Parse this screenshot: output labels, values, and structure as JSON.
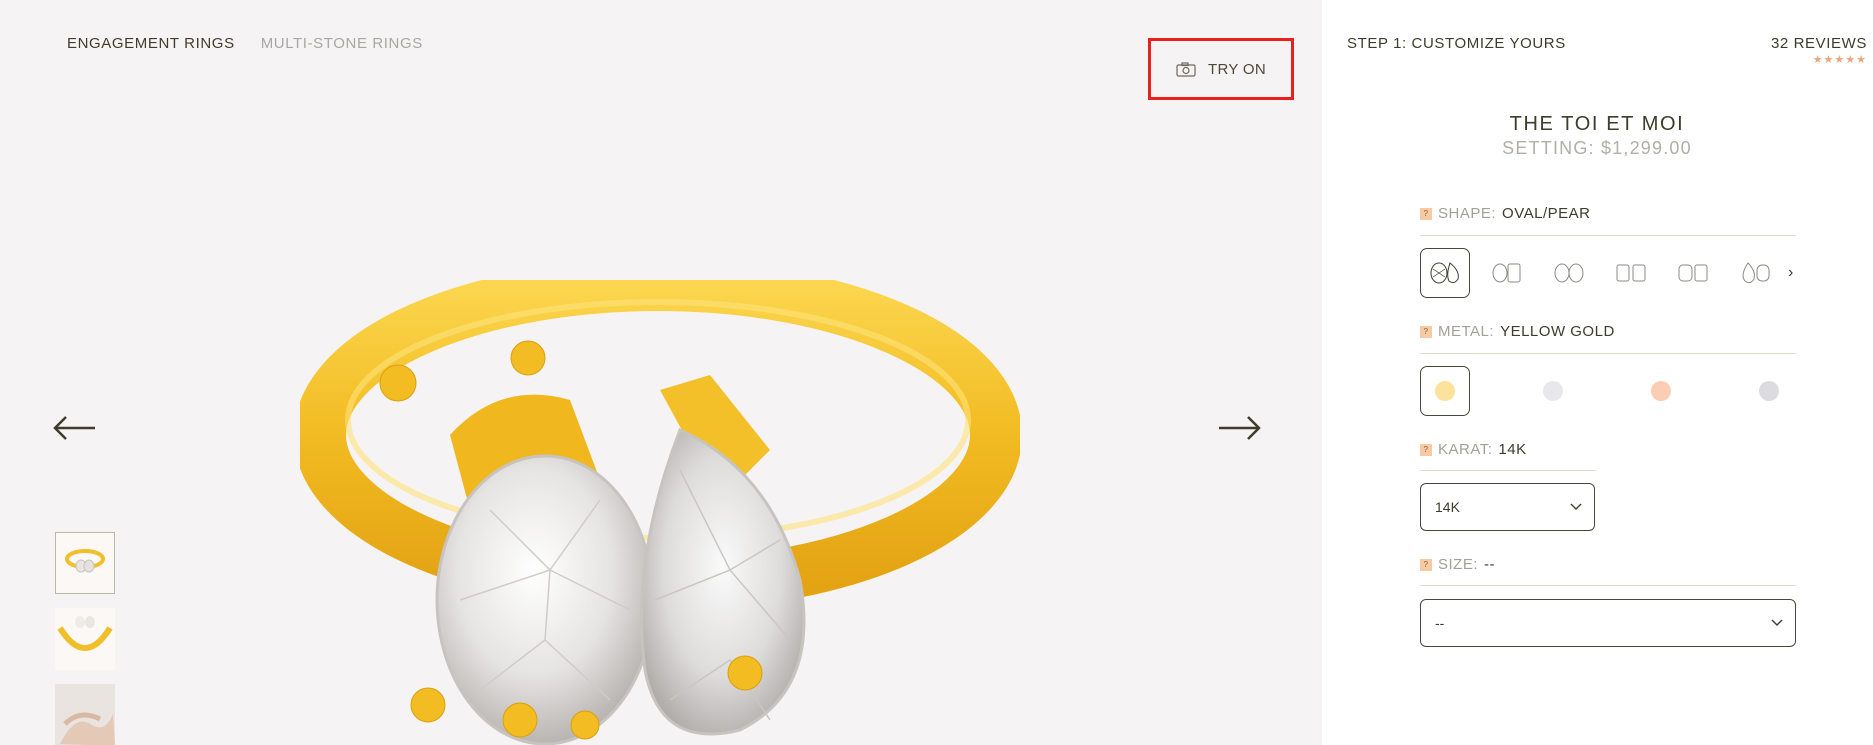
{
  "breadcrumb": {
    "items": [
      "ENGAGEMENT RINGS",
      "MULTI-STONE RINGS"
    ]
  },
  "try_on": {
    "label": "TRY ON",
    "icon": "camera-icon"
  },
  "product": {
    "step": "STEP 1: CUSTOMIZE YOURS",
    "reviews": "32 REVIEWS",
    "stars": "★★★★★",
    "title": "THE TOI ET MOI",
    "price": "SETTING: $1,299.00"
  },
  "options": {
    "shape": {
      "label": "SHAPE:",
      "value": "OVAL/PEAR",
      "help": "?"
    },
    "metal": {
      "label": "METAL:",
      "value": "YELLOW GOLD",
      "help": "?"
    },
    "karat": {
      "label": "KARAT:",
      "value": "14K",
      "help": "?",
      "selected": "14K"
    },
    "size": {
      "label": "SIZE:",
      "value": "--",
      "help": "?",
      "selected": "--"
    }
  },
  "shapes": [
    "oval-pear",
    "oval-emerald",
    "oval-oval",
    "emerald-emerald",
    "cushion-emerald",
    "pear-oval"
  ],
  "metals": [
    {
      "name": "yellow-gold",
      "color": "#fbe39b"
    },
    {
      "name": "white-gold",
      "color": "#e8e7ea"
    },
    {
      "name": "rose-gold",
      "color": "#fbcdb5"
    },
    {
      "name": "platinum",
      "color": "#dcdbe0"
    }
  ],
  "colors": {
    "accent": "#3e3c2c",
    "gold": "#f2c230",
    "highlight_box": "#e8211f",
    "background": "#f6f3f5"
  }
}
